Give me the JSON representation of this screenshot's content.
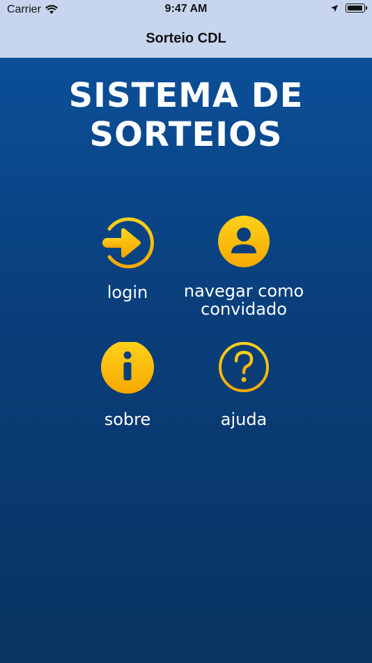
{
  "status": {
    "carrier": "Carrier",
    "time": "9:47 AM"
  },
  "nav": {
    "title": "Sorteio CDL"
  },
  "headline": {
    "line1": "SISTEMA DE",
    "line2": "SORTEIOS"
  },
  "menu": {
    "login": "login",
    "guest": "navegar como convidado",
    "about": "sobre",
    "help": "ajuda"
  },
  "colors": {
    "accent_yellow": "#ffc20e",
    "background_blue": "#0b4f98",
    "nav_bar": "#c7d6ee"
  }
}
